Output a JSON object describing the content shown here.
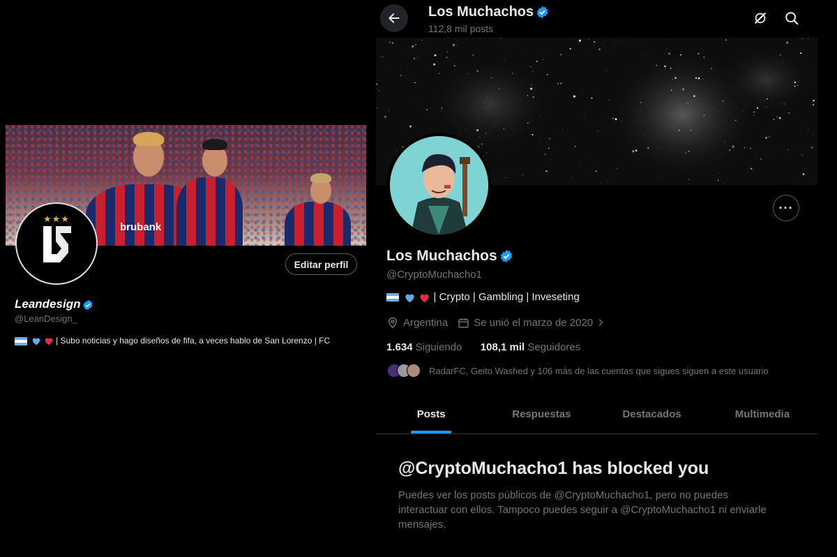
{
  "left_profile": {
    "name": "Leandesign",
    "handle": "@LeanDesign_",
    "bio": "| Subo noticias y hago diseños de fifa, a veces hablo de San Lorenzo | FC",
    "edit_button_label": "Editar perfil",
    "banner_sponsor": "brubank",
    "avatar_stars": "★★★"
  },
  "right_profile": {
    "header": {
      "name": "Los Muchachos",
      "posts_count": "112,8 mil posts"
    },
    "name": "Los Muchachos",
    "handle": "@CryptoMuchacho1",
    "bio": "| Crypto | Gambling | Inveseting",
    "location": "Argentina",
    "joined": "Se unió el marzo de 2020",
    "following_count": "1.634",
    "following_label": "Siguiendo",
    "followers_count": "108,1 mil",
    "followers_label": "Seguidores",
    "known_followers": "RadarFC, Geito Washed y 106 más de las cuentas que sigues siguen a este usuario",
    "more_label": "···"
  },
  "tabs": [
    {
      "label": "Posts",
      "active": true
    },
    {
      "label": "Respuestas",
      "active": false
    },
    {
      "label": "Destacados",
      "active": false
    },
    {
      "label": "Multimedia",
      "active": false
    }
  ],
  "blocked": {
    "title": "@CryptoMuchacho1 has blocked you",
    "text": "Puedes ver los posts públicos de @CryptoMuchacho1, pero no puedes interactuar con ellos. Tampoco puedes seguir a @CryptoMuchacho1 ni enviarle mensajes."
  },
  "icons": {
    "back": "arrow-left-icon",
    "grok": "grok-icon",
    "search": "search-icon",
    "verified": "verified-badge-icon",
    "location": "location-pin-icon",
    "calendar": "calendar-icon"
  },
  "colors": {
    "accent": "#1d9bf0",
    "background": "#000000",
    "text_primary": "#e7e9ea",
    "text_secondary": "#71767b",
    "jersey_blue": "#1b2a6b",
    "jersey_red": "#c9202f"
  }
}
